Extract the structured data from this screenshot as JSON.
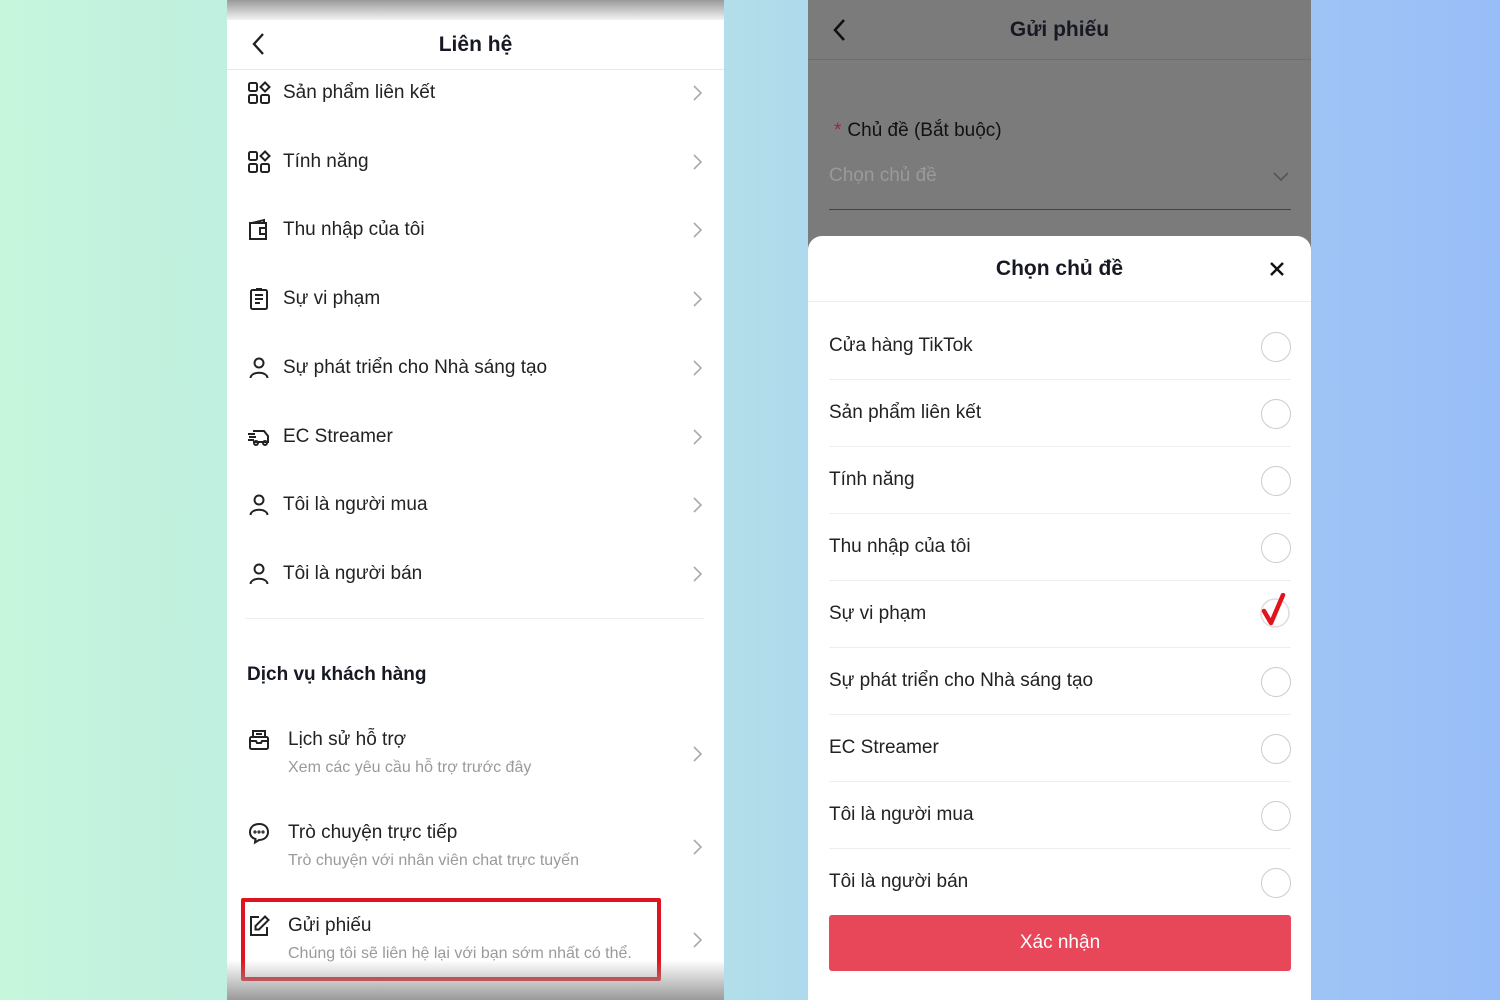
{
  "left": {
    "title": "Liên hệ",
    "items": [
      {
        "label": "Sản phẩm liên kết",
        "icon": "grid-icon"
      },
      {
        "label": "Tính năng",
        "icon": "grid-icon"
      },
      {
        "label": "Thu nhập của tôi",
        "icon": "wallet-icon"
      },
      {
        "label": "Sự vi phạm",
        "icon": "clipboard-icon"
      },
      {
        "label": "Sự phát triển cho Nhà sáng tạo",
        "icon": "user-icon"
      },
      {
        "label": "EC Streamer",
        "icon": "truck-icon"
      },
      {
        "label": "Tôi là người mua",
        "icon": "user-icon"
      },
      {
        "label": "Tôi là người bán",
        "icon": "user-icon"
      }
    ],
    "section_title": "Dịch vụ khách hàng",
    "services": [
      {
        "label": "Lịch sử hỗ trợ",
        "sub": "Xem các yêu cầu hỗ trợ trước đây",
        "icon": "inbox-icon"
      },
      {
        "label": "Trò chuyện trực tiếp",
        "sub": "Trò chuyện với nhân viên chat trực tuyến",
        "icon": "chat-icon"
      },
      {
        "label": "Gửi phiếu",
        "sub": "Chúng tôi sẽ liên hệ lại với bạn sớm nhất có thể.",
        "icon": "edit-icon",
        "highlighted": true
      }
    ]
  },
  "right": {
    "title": "Gửi phiếu",
    "field_label": "Chủ đề (Bắt buộc)",
    "required_mark": "*",
    "field_placeholder": "Chọn chủ đề",
    "sheet_title": "Chọn chủ đề",
    "options": [
      {
        "label": "Cửa hàng TikTok",
        "selected": false
      },
      {
        "label": "Sản phẩm liên kết",
        "selected": false
      },
      {
        "label": "Tính năng",
        "selected": false
      },
      {
        "label": "Thu nhập của tôi",
        "selected": false
      },
      {
        "label": "Sự vi phạm",
        "selected": true
      },
      {
        "label": "Sự phát triển cho Nhà sáng tạo",
        "selected": false
      },
      {
        "label": "EC Streamer",
        "selected": false
      },
      {
        "label": "Tôi là người mua",
        "selected": false
      },
      {
        "label": "Tôi là người bán",
        "selected": false
      }
    ],
    "confirm_label": "Xác nhận"
  },
  "colors": {
    "accent": "#e84659",
    "highlight": "#e0141e",
    "check": "#e0141e"
  }
}
